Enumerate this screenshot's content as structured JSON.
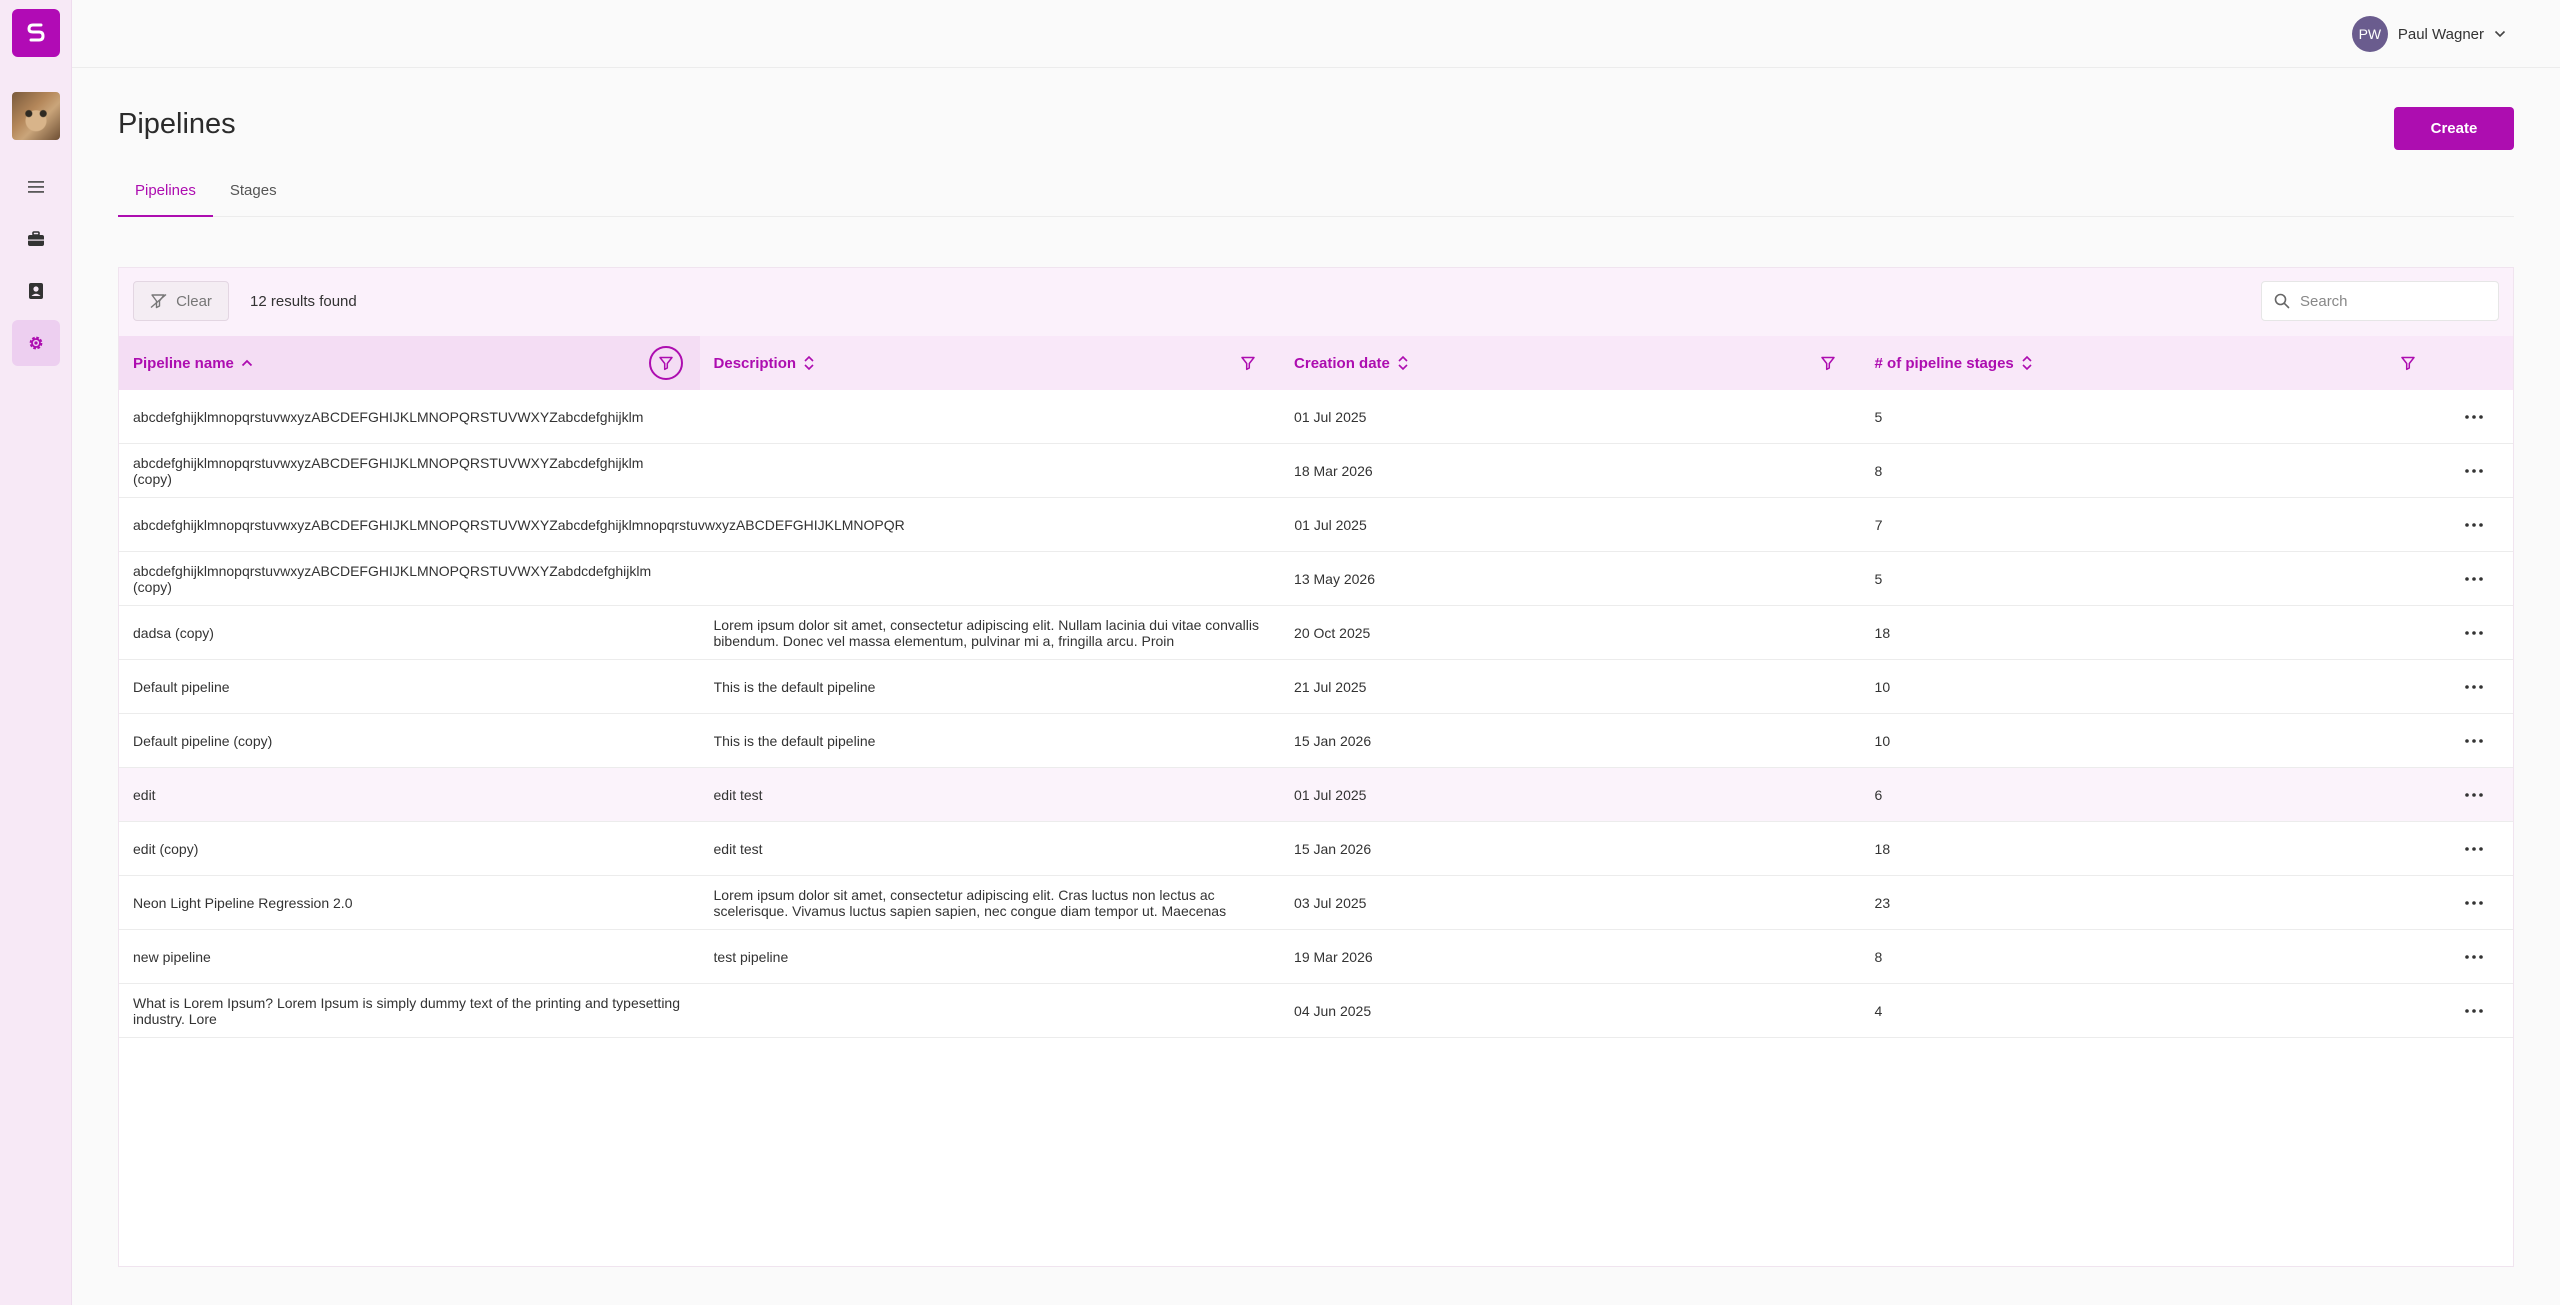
{
  "user": {
    "initials": "PW",
    "name": "Paul Wagner"
  },
  "page": {
    "title": "Pipelines",
    "create_label": "Create"
  },
  "tabs": [
    {
      "label": "Pipelines"
    },
    {
      "label": "Stages"
    }
  ],
  "toolbar": {
    "clear_label": "Clear",
    "results_text": "12 results found",
    "search_placeholder": "Search"
  },
  "columns": [
    {
      "label": "Pipeline name"
    },
    {
      "label": "Description"
    },
    {
      "label": "Creation date"
    },
    {
      "label": "# of pipeline stages"
    }
  ],
  "rows": [
    {
      "name": "abcdefghijklmnopqrstuvwxyzABCDEFGHIJKLMNOPQRSTUVWXYZabcdefghijklm",
      "description": "",
      "date": "01 Jul 2025",
      "stages": "5"
    },
    {
      "name": "abcdefghijklmnopqrstuvwxyzABCDEFGHIJKLMNOPQRSTUVWXYZabcdefghijklm (copy)",
      "description": "",
      "date": "18 Mar 2026",
      "stages": "8"
    },
    {
      "name": "abcdefghijklmnopqrstuvwxyzABCDEFGHIJKLMNOPQRSTUVWXYZabcdefghijklmnopqrstuvwxyzABCDEFGHIJKLMNOPQR",
      "description": "",
      "date": "01 Jul 2025",
      "stages": "7"
    },
    {
      "name": "abcdefghijklmnopqrstuvwxyzABCDEFGHIJKLMNOPQRSTUVWXYZabdcdefghijklm (copy)",
      "description": "",
      "date": "13 May 2026",
      "stages": "5"
    },
    {
      "name": "dadsa (copy)",
      "description": "Lorem ipsum dolor sit amet, consectetur adipiscing elit. Nullam lacinia dui vitae convallis bibendum. Donec vel massa elementum, pulvinar mi a, fringilla arcu. Proin",
      "date": "20 Oct 2025",
      "stages": "18"
    },
    {
      "name": "Default pipeline",
      "description": "This is the default pipeline",
      "date": "21 Jul 2025",
      "stages": "10"
    },
    {
      "name": "Default pipeline (copy)",
      "description": "This is the default pipeline",
      "date": "15 Jan 2026",
      "stages": "10"
    },
    {
      "name": "edit",
      "description": "edit test",
      "date": "01 Jul 2025",
      "stages": "6"
    },
    {
      "name": "edit (copy)",
      "description": "edit test",
      "date": "15 Jan 2026",
      "stages": "18"
    },
    {
      "name": "Neon Light Pipeline Regression 2.0",
      "description": "Lorem ipsum dolor sit amet, consectetur adipiscing elit. Cras luctus non lectus ac scelerisque. Vivamus luctus sapien sapien, nec congue diam tempor ut. Maecenas",
      "date": "03 Jul 2025",
      "stages": "23"
    },
    {
      "name": "new pipeline",
      "description": "test pipeline",
      "date": "19 Mar 2026",
      "stages": "8"
    },
    {
      "name": "What is Lorem Ipsum? Lorem Ipsum is simply dummy text of the printing and typesetting industry. Lore",
      "description": "",
      "date": "04 Jun 2025",
      "stages": "4"
    }
  ],
  "colors": {
    "accent": "#ad0db0",
    "sidebar_bg": "#f7e9f6",
    "header_bg": "#f9e8f9"
  },
  "icons": {
    "sidebar": [
      "menu-icon",
      "briefcase-icon",
      "contact-card-icon",
      "settings-gear-icon"
    ],
    "row_action": "more-horizontal-icon",
    "header_filter": "filter-funnel-icon",
    "clear": "filter-clear-icon",
    "search": "search-icon"
  }
}
